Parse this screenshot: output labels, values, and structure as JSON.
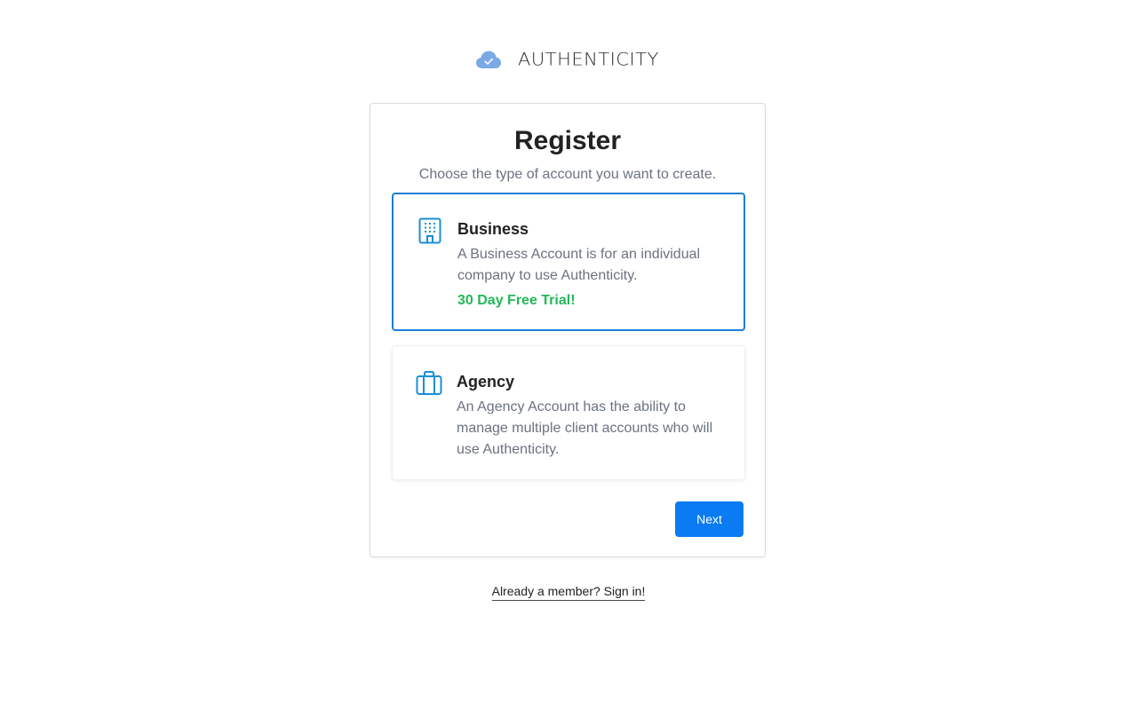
{
  "brand": {
    "name": "AUTHENTICITY",
    "logo_icon": "cloud-check-icon",
    "logo_color": "#7aa9e6"
  },
  "register": {
    "title": "Register",
    "subtitle": "Choose the type of account you want to create.",
    "options": [
      {
        "name": "Business",
        "description": "A Business Account is for an individual company to use Authenticity.",
        "badge": "30 Day Free Trial!",
        "icon": "building-icon",
        "selected": true
      },
      {
        "name": "Agency",
        "description": "An Agency Account has the ability to manage multiple client accounts who will use Authenticity.",
        "icon": "briefcase-icon",
        "selected": false
      }
    ],
    "next_label": "Next"
  },
  "footer": {
    "signin_label": "Already a member? Sign in!"
  },
  "colors": {
    "accent": "#0a7bf2",
    "selected_border": "#1a7fd4",
    "icon": "#1a8fd6",
    "trial": "#22b85a"
  }
}
